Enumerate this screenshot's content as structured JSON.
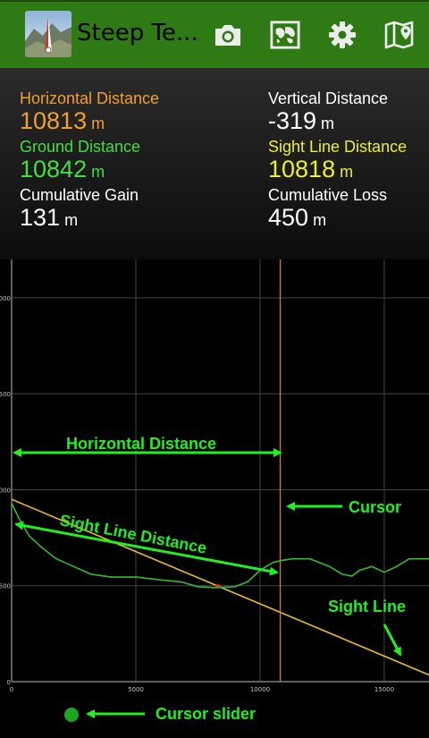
{
  "app": {
    "title": "Steep Te...",
    "toolbar_icons": [
      "camera-icon",
      "map-image-icon",
      "gear-icon",
      "map-pin-icon"
    ]
  },
  "stats": {
    "horizontal_distance": {
      "label": "Horizontal Distance",
      "value": "10813",
      "unit": "m",
      "color": "#f0a030"
    },
    "vertical_distance": {
      "label": "Vertical Distance",
      "value": "-319",
      "unit": "m",
      "color": "#ffffff"
    },
    "ground_distance": {
      "label": "Ground Distance",
      "value": "10842",
      "unit": "m",
      "color": "#44dd44"
    },
    "sight_line_distance": {
      "label": "Sight Line Distance",
      "value": "10818",
      "unit": "m",
      "color": "#eeee33"
    },
    "cumulative_gain": {
      "label": "Cumulative Gain",
      "value": "131",
      "unit": "m",
      "color": "#ffffff"
    },
    "cumulative_loss": {
      "label": "Cumulative Loss",
      "value": "450",
      "unit": "m",
      "color": "#ffffff"
    }
  },
  "annotations": {
    "horizontal_distance": "Horizontal Distance",
    "cursor": "Cursor",
    "sight_line_distance": "Sight Line Distance",
    "sight_line": "Sight Line",
    "cursor_slider": "Cursor slider"
  },
  "chart_data": {
    "type": "line",
    "xlim": [
      0,
      16800
    ],
    "ylim": [
      0,
      2200
    ],
    "x_ticks": [
      0,
      5000,
      10000,
      15000
    ],
    "x_tick_labels": [
      "0",
      "5000",
      "10000",
      "15000"
    ],
    "y_ticks": [
      0,
      500,
      1000,
      1500,
      2000
    ],
    "y_tick_labels": [
      "0",
      "500",
      "1000",
      "1500",
      "2000"
    ],
    "grid": true,
    "cursor_x": 10813,
    "cursor_slider_position": 0,
    "sight_line": {
      "x": [
        0,
        16800
      ],
      "y": [
        950,
        35
      ],
      "color": "#e8c020"
    },
    "sight_line_min_marker": {
      "x": 8300,
      "y": 500
    },
    "series": [
      {
        "color": "#33bb33",
        "x": [
          0,
          300,
          700,
          1200,
          1800,
          2500,
          3200,
          4000,
          5000,
          6000,
          6800,
          7500,
          8200,
          9000,
          9500,
          10000,
          10500,
          10813,
          11300,
          12000,
          12800,
          13300,
          13700,
          14000,
          14500,
          15000,
          15500,
          16000,
          16800
        ],
        "y": [
          930,
          850,
          760,
          700,
          640,
          600,
          560,
          545,
          545,
          530,
          520,
          495,
          490,
          495,
          520,
          580,
          620,
          630,
          640,
          640,
          600,
          560,
          550,
          580,
          600,
          570,
          600,
          640,
          640
        ]
      }
    ]
  }
}
